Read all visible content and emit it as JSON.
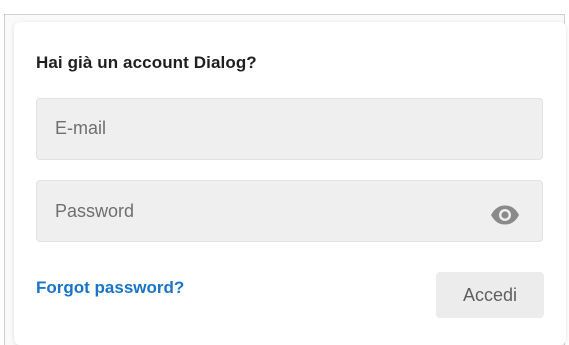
{
  "login": {
    "title": "Hai già un account Dialog?",
    "email": {
      "placeholder": "E-mail",
      "value": ""
    },
    "password": {
      "placeholder": "Password",
      "value": "",
      "toggle_icon": "eye-icon"
    },
    "forgot_label": "Forgot password?",
    "submit_label": "Accedi"
  },
  "colors": {
    "link": "#1a73c8",
    "field_bg": "#efefef",
    "button_bg": "#ececec",
    "title": "#1f1f1f"
  }
}
